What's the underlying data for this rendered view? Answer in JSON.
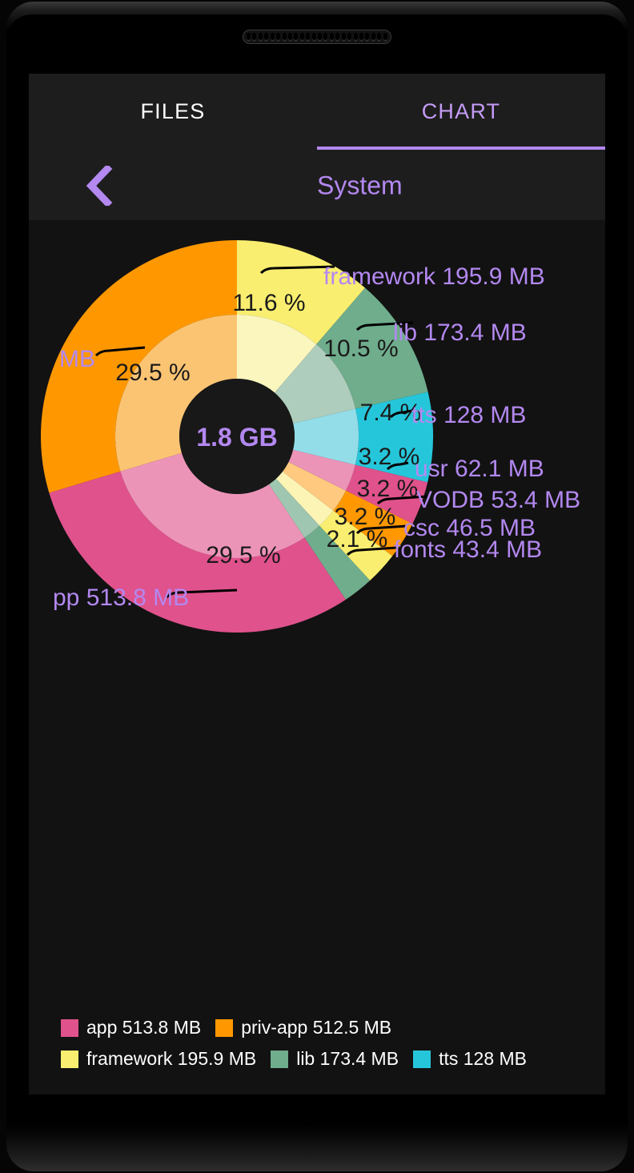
{
  "device": {
    "speaker_hole_count": 24
  },
  "tabs": [
    {
      "label": "FILES",
      "active": false
    },
    {
      "label": "CHART",
      "active": true
    }
  ],
  "titlebar": {
    "back_icon": "chevron-left-icon",
    "title": "System"
  },
  "center": {
    "total": "1.8 GB"
  },
  "legend": [
    {
      "label": "app 513.8 MB",
      "color": "#E0528C"
    },
    {
      "label": "priv-app 512.5 MB",
      "color": "#FF9800"
    },
    {
      "label": "framework 195.9 MB",
      "color": "#FAEE70"
    },
    {
      "label": "lib 173.4 MB",
      "color": "#6FAD8C"
    },
    {
      "label": "tts 128 MB",
      "color": "#26C6DA"
    }
  ],
  "chart_data": {
    "type": "pie",
    "title": "System",
    "center_label": "1.8 GB",
    "total_bytes_label": "1.8 GB",
    "ring_count": 2,
    "legend_position": "bottom-left",
    "grid": false,
    "categories": [
      "priv-app",
      "framework",
      "lib",
      "tts",
      "usr",
      "VODB",
      "csc",
      "fonts",
      "app"
    ],
    "values": [
      512.5,
      195.9,
      173.4,
      128,
      62.1,
      53.4,
      46.5,
      43.4,
      513.8
    ],
    "value_unit": "MB",
    "percent_labels": [
      "29.5 %",
      "11.6 %",
      "10.5 %",
      "7.4 %",
      "3.2 %",
      "3.2 %",
      "3.2 %",
      "2.1 %",
      "29.5 %"
    ],
    "outer_colors": [
      "#FF9800",
      "#FAEE70",
      "#6FAD8C",
      "#26C6DA",
      "#E0528C",
      "#FF9800",
      "#FAEE70",
      "#6FAD8C",
      "#E0528C"
    ],
    "inner_colors": [
      "#FBC473",
      "#FAF6BE",
      "#AFCDBC",
      "#93DDE8",
      "#EC94B8",
      "#FFC97F",
      "#FCF4B4",
      "#9FC6B1",
      "#EC94B8"
    ],
    "slices": [
      {
        "name": "priv-app",
        "value": 512.5,
        "percent": 29.5,
        "percent_label": "29.5 %",
        "outside_label": "priv-app 512.5 MB",
        "outside_label_visible": "MB",
        "color": "#FF9800",
        "inner_color": "#FBC473"
      },
      {
        "name": "framework",
        "value": 195.9,
        "percent": 11.6,
        "percent_label": "11.6 %",
        "outside_label": "framework 195.9 MB",
        "outside_label_visible": "framework 195.9 MB",
        "color": "#FAEE70",
        "inner_color": "#FAF6BE"
      },
      {
        "name": "lib",
        "value": 173.4,
        "percent": 10.5,
        "percent_label": "10.5 %",
        "outside_label": "lib 173.4 MB",
        "outside_label_visible": "lib 173.4 MB",
        "color": "#6FAD8C",
        "inner_color": "#AFCDBC"
      },
      {
        "name": "tts",
        "value": 128.0,
        "percent": 7.4,
        "percent_label": "7.4 %",
        "outside_label": "tts 128 MB",
        "outside_label_visible": "tts 128 MB",
        "color": "#26C6DA",
        "inner_color": "#93DDE8"
      },
      {
        "name": "usr",
        "value": 62.1,
        "percent": 3.2,
        "percent_label": "3.2 %",
        "outside_label": "usr 62.1 MB",
        "outside_label_visible": "usr 62.1 MB",
        "color": "#E0528C",
        "inner_color": "#EC94B8"
      },
      {
        "name": "VODB",
        "value": 53.4,
        "percent": 3.2,
        "percent_label": "3.2 %",
        "outside_label": "VODB 53.4 MB",
        "outside_label_visible": "VODB 53.4 MB",
        "color": "#FF9800",
        "inner_color": "#FFC97F"
      },
      {
        "name": "csc",
        "value": 46.5,
        "percent": 3.2,
        "percent_label": "3.2 %",
        "outside_label": "csc 46.5 MB",
        "outside_label_visible": "csc 46.5 MB",
        "color": "#FAEE70",
        "inner_color": "#FCF4B4"
      },
      {
        "name": "fonts",
        "value": 43.4,
        "percent": 2.1,
        "percent_label": "2.1 %",
        "outside_label": "fonts 43.4 MB",
        "outside_label_visible": "fonts 43.4 MB",
        "color": "#6FAD8C",
        "inner_color": "#9FC6B1"
      },
      {
        "name": "app",
        "value": 513.8,
        "percent": 29.5,
        "percent_label": "29.5 %",
        "outside_label": "app 513.8 MB",
        "outside_label_visible": "pp 513.8 MB",
        "color": "#E0528C",
        "inner_color": "#EC94B8"
      }
    ],
    "labels": {
      "percent_color": "#1a1a1a",
      "outside_color": "#b388f0",
      "leader_color": "#000000"
    }
  }
}
